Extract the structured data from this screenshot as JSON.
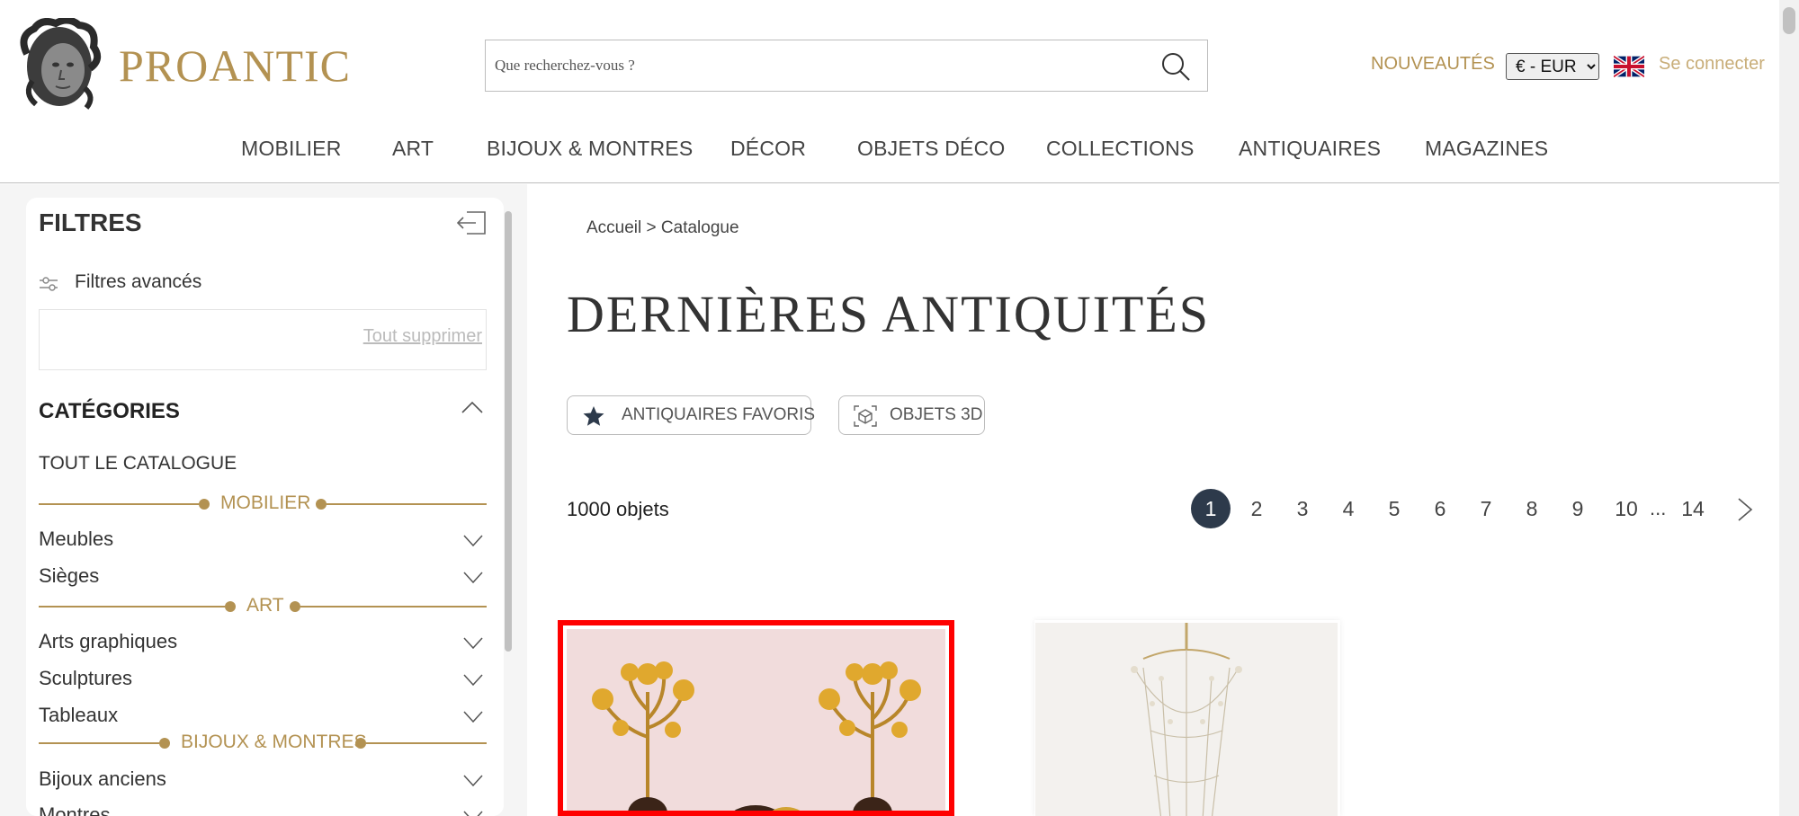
{
  "header": {
    "brand": "PROANTIC",
    "search_placeholder": "Que recherchez-vous ?",
    "nouveautes": "NOUVEAUTÉS",
    "currency": "€ - EUR",
    "connect": "Se connecter",
    "nav": [
      "MOBILIER",
      "ART",
      "BIJOUX & MONTRES",
      "DÉCOR",
      "OBJETS DÉCO",
      "COLLECTIONS",
      "ANTIQUAIRES",
      "MAGAZINES"
    ]
  },
  "sidebar": {
    "title": "FILTRES",
    "advanced": "Filtres avancés",
    "clear_all": "Tout supprimer",
    "categories_title": "CATÉGORIES",
    "all_catalog": "TOUT LE CATALOGUE",
    "groups": [
      {
        "label": "MOBILIER",
        "items": [
          "Meubles",
          "Sièges"
        ]
      },
      {
        "label": "ART",
        "items": [
          "Arts graphiques",
          "Sculptures",
          "Tableaux"
        ]
      },
      {
        "label": "BIJOUX & MONTRES",
        "items": [
          "Bijoux anciens",
          "Montres"
        ]
      }
    ]
  },
  "main": {
    "breadcrumb": "Accueil > Catalogue",
    "title": "DERNIÈRES ANTIQUITÉS",
    "chip_favorites": "ANTIQUAIRES FAVORIS",
    "chip_3d": "OBJETS 3D",
    "count": "1000 objets",
    "pages": [
      "1",
      "2",
      "3",
      "4",
      "5",
      "6",
      "7",
      "8",
      "9",
      "10"
    ],
    "ellipsis": "...",
    "last_page": "14",
    "active_page": "1"
  },
  "colors": {
    "gold": "#b39252",
    "dark": "#2d3a4b",
    "highlight": "#ff0000"
  },
  "icons": [
    "search-icon",
    "uk-flag-icon",
    "collapse-panel-icon",
    "sliders-icon",
    "chevron-up-icon",
    "chevron-down-icon",
    "star-icon",
    "cube-3d-icon",
    "chevron-right-icon"
  ]
}
